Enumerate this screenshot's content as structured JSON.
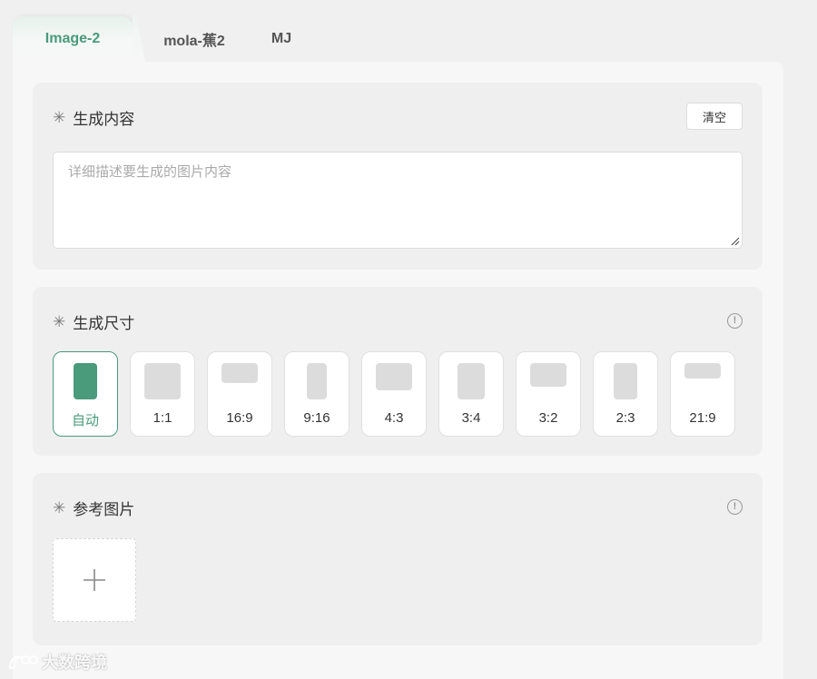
{
  "tabs": [
    {
      "label": "Image-2",
      "active": true
    },
    {
      "label": "mola-蕉2",
      "active": false
    },
    {
      "label": "MJ",
      "active": false
    }
  ],
  "content_section": {
    "asterisk": "✳",
    "title": "生成内容",
    "clear_label": "清空",
    "prompt_placeholder": "详细描述要生成的图片内容",
    "prompt_value": ""
  },
  "size_section": {
    "asterisk": "✳",
    "title": "生成尺寸",
    "info_glyph": "!",
    "selected": "自动",
    "options": [
      {
        "label": "自动"
      },
      {
        "label": "1:1"
      },
      {
        "label": "16:9"
      },
      {
        "label": "9:16"
      },
      {
        "label": "4:3"
      },
      {
        "label": "3:4"
      },
      {
        "label": "3:2"
      },
      {
        "label": "2:3"
      },
      {
        "label": "21:9"
      }
    ]
  },
  "reference_section": {
    "asterisk": "✳",
    "title": "参考图片",
    "info_glyph": "!"
  },
  "watermark": {
    "text": "大数跨境"
  },
  "colors": {
    "accent": "#4a9a7c",
    "placeholder_shape": "#dcdcdc"
  },
  "icons": [
    "info-icon",
    "plus-icon",
    "resize-grip-icon",
    "logo-icon"
  ]
}
